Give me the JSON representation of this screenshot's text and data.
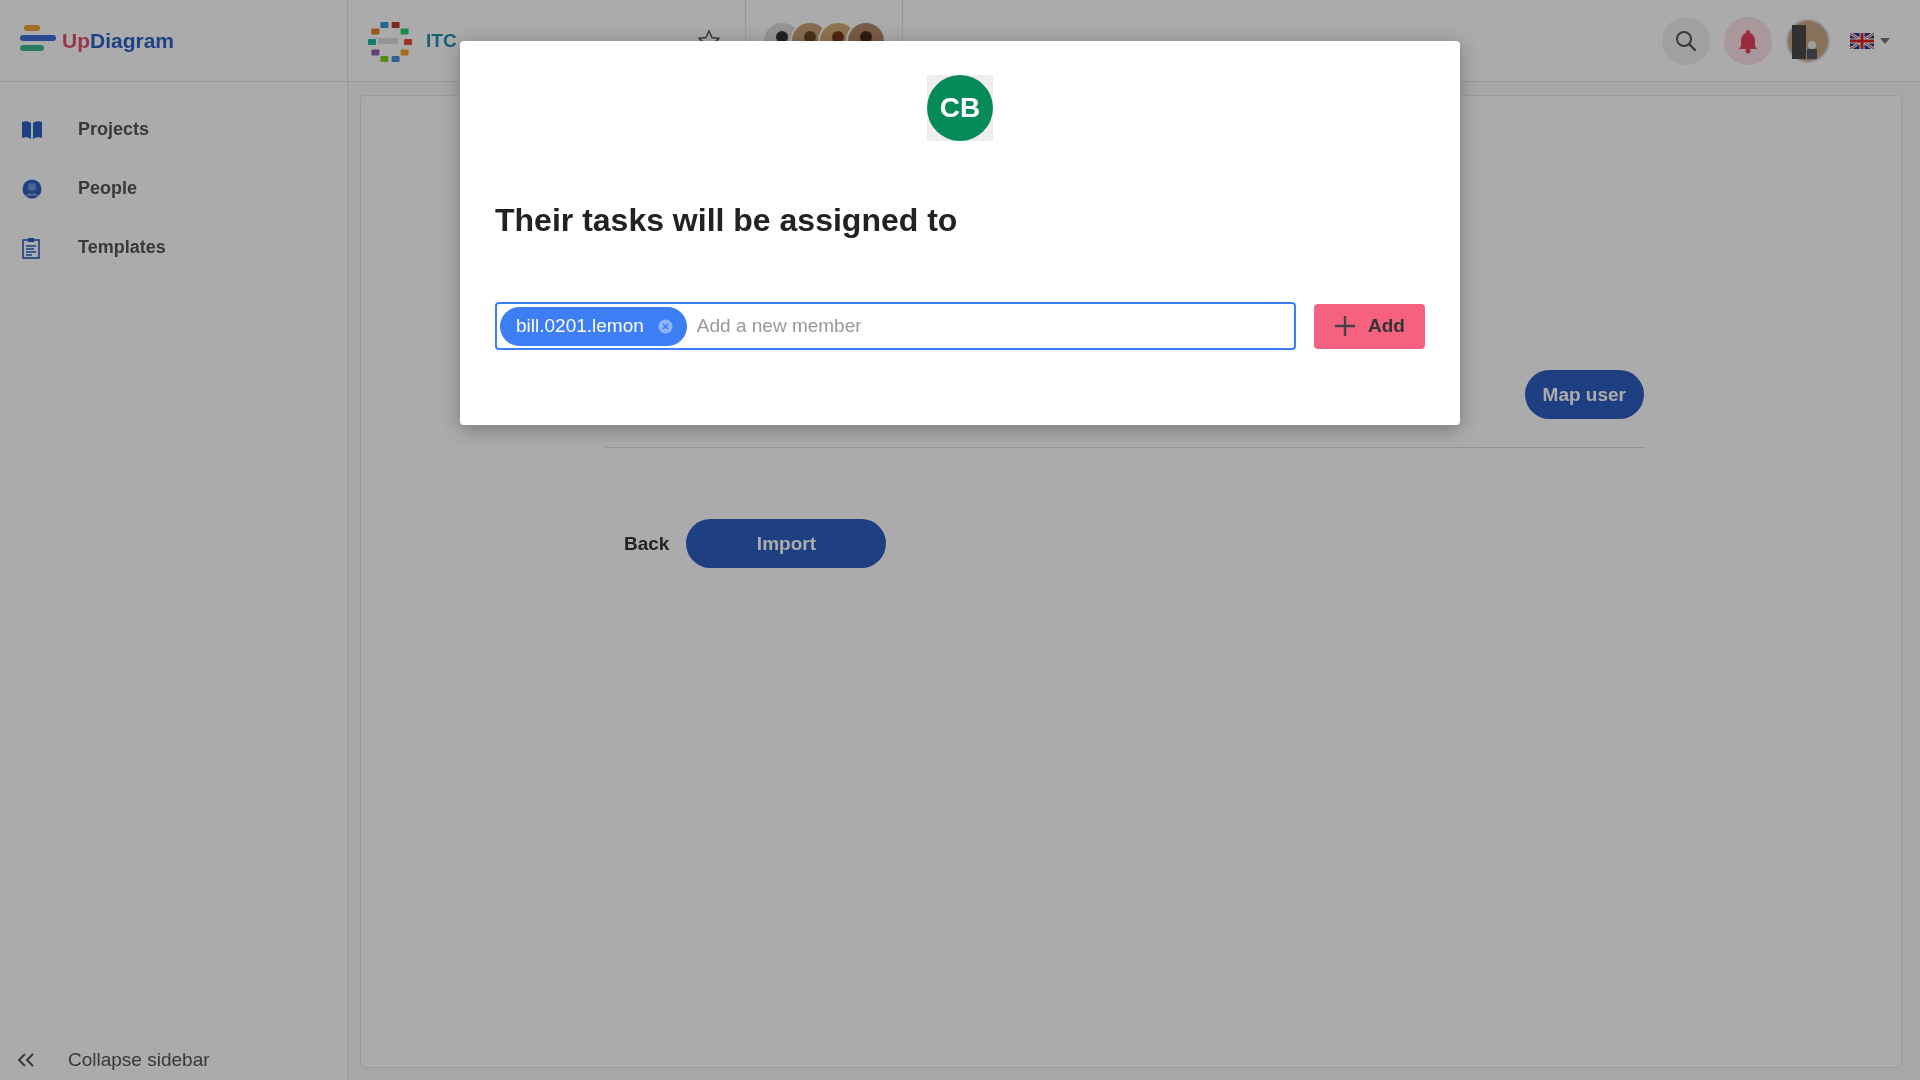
{
  "brand": {
    "first": "Up",
    "second": "Diagram"
  },
  "project": {
    "name": "ITC",
    "starred": false
  },
  "sidebar": {
    "items": [
      {
        "label": "Projects",
        "kind": "book"
      },
      {
        "label": "People",
        "kind": "person"
      },
      {
        "label": "Templates",
        "kind": "clipboard"
      }
    ],
    "collapse": "Collapse sidebar"
  },
  "main": {
    "map_button": "Map user",
    "back": "Back",
    "import": "Import"
  },
  "modal": {
    "initials": "CB",
    "title": "Their tasks will be assigned to",
    "chips": [
      {
        "label": "bill.0201.lemon"
      }
    ],
    "placeholder": "Add a new member",
    "add_button": "Add"
  }
}
